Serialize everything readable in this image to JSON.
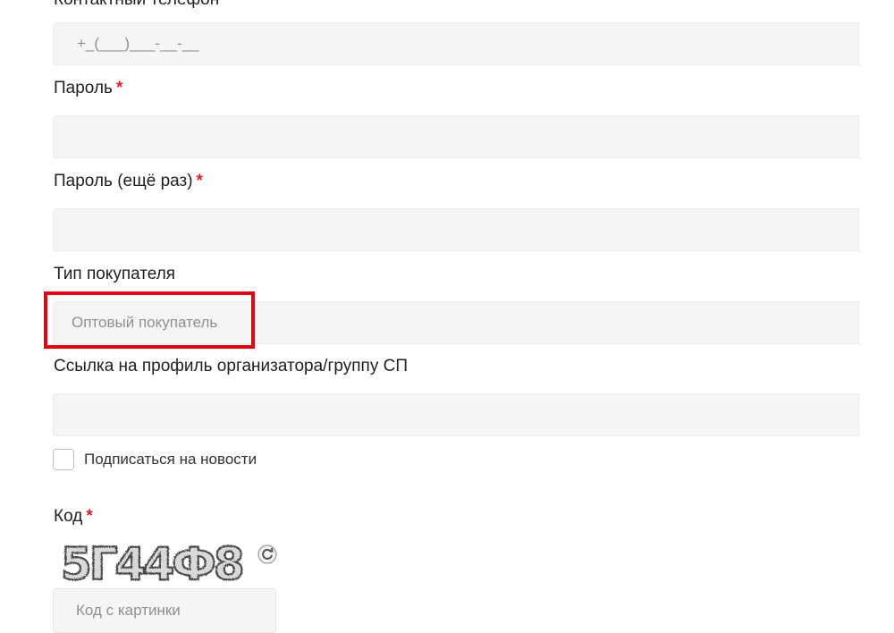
{
  "form": {
    "phone": {
      "label": "Контактный телефон",
      "placeholder": "+_(___)___-__-__"
    },
    "password": {
      "label": "Пароль",
      "required_mark": "*"
    },
    "password_repeat": {
      "label": "Пароль (ещё раз)",
      "required_mark": "*"
    },
    "buyer_type": {
      "label": "Тип покупателя",
      "value": "Оптовый покупатель"
    },
    "organizer_link": {
      "label": "Ссылка на профиль организатора/группу СП"
    },
    "subscribe": {
      "label": "Подписаться на новости",
      "checked": false
    },
    "captcha": {
      "label": "Код",
      "required_mark": "*",
      "image_text": "5Г44Ф8",
      "input_placeholder": "Код с картинки"
    }
  },
  "colors": {
    "required": "#e0202a",
    "highlight": "#e4000f",
    "field_bg": "#f5f5f5",
    "placeholder": "#8f8f8f"
  },
  "icons": {
    "refresh": "refresh-icon"
  }
}
